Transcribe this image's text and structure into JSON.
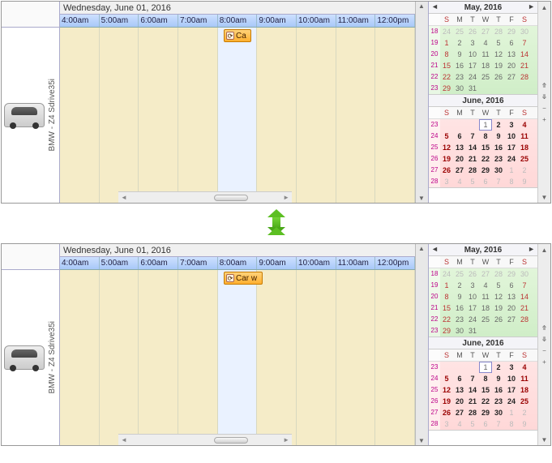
{
  "scheduler": {
    "date_header": "Wednesday, June 01, 2016",
    "hours": [
      "4:00am",
      "5:00am",
      "6:00am",
      "7:00am",
      "8:00am",
      "9:00am",
      "10:00am",
      "11:00am",
      "12:00pm"
    ],
    "resource_label": "BMW - Z4 Sdrive35i",
    "appt_top_label": "Ca",
    "appt_bottom_label": "Car w"
  },
  "calendars": {
    "may": {
      "title": "May, 2016",
      "dow": [
        "S",
        "M",
        "T",
        "W",
        "T",
        "F",
        "S"
      ],
      "rows": [
        {
          "wk": "18",
          "days": [
            {
              "v": "24",
              "dim": 1
            },
            {
              "v": "25",
              "dim": 1
            },
            {
              "v": "26",
              "dim": 1
            },
            {
              "v": "27",
              "dim": 1
            },
            {
              "v": "28",
              "dim": 1
            },
            {
              "v": "29",
              "dim": 1
            },
            {
              "v": "30",
              "dim": 1
            }
          ]
        },
        {
          "wk": "19",
          "days": [
            {
              "v": "1",
              "w": 1
            },
            {
              "v": "2"
            },
            {
              "v": "3"
            },
            {
              "v": "4"
            },
            {
              "v": "5"
            },
            {
              "v": "6"
            },
            {
              "v": "7",
              "w": 1
            }
          ]
        },
        {
          "wk": "20",
          "days": [
            {
              "v": "8",
              "w": 1
            },
            {
              "v": "9"
            },
            {
              "v": "10"
            },
            {
              "v": "11"
            },
            {
              "v": "12"
            },
            {
              "v": "13"
            },
            {
              "v": "14",
              "w": 1
            }
          ]
        },
        {
          "wk": "21",
          "days": [
            {
              "v": "15",
              "w": 1
            },
            {
              "v": "16"
            },
            {
              "v": "17"
            },
            {
              "v": "18"
            },
            {
              "v": "19"
            },
            {
              "v": "20"
            },
            {
              "v": "21",
              "w": 1
            }
          ]
        },
        {
          "wk": "22",
          "days": [
            {
              "v": "22",
              "w": 1
            },
            {
              "v": "23"
            },
            {
              "v": "24"
            },
            {
              "v": "25"
            },
            {
              "v": "26"
            },
            {
              "v": "27"
            },
            {
              "v": "28",
              "w": 1
            }
          ]
        },
        {
          "wk": "23",
          "days": [
            {
              "v": "29",
              "w": 1
            },
            {
              "v": "30"
            },
            {
              "v": "31"
            }
          ]
        }
      ]
    },
    "jun": {
      "title": "June, 2016",
      "dow": [
        "S",
        "M",
        "T",
        "W",
        "T",
        "F",
        "S"
      ],
      "rows": [
        {
          "wk": "23",
          "days": [
            {
              "v": ""
            },
            {
              "v": ""
            },
            {
              "v": ""
            },
            {
              "v": "1",
              "today": 1
            },
            {
              "v": "2",
              "b": 1
            },
            {
              "v": "3",
              "b": 1
            },
            {
              "v": "4",
              "b": 1,
              "w": 1
            }
          ]
        },
        {
          "wk": "24",
          "days": [
            {
              "v": "5",
              "b": 1,
              "w": 1
            },
            {
              "v": "6",
              "b": 1
            },
            {
              "v": "7",
              "b": 1
            },
            {
              "v": "8",
              "b": 1
            },
            {
              "v": "9",
              "b": 1
            },
            {
              "v": "10",
              "b": 1
            },
            {
              "v": "11",
              "b": 1,
              "w": 1
            }
          ]
        },
        {
          "wk": "25",
          "days": [
            {
              "v": "12",
              "b": 1,
              "w": 1
            },
            {
              "v": "13",
              "b": 1
            },
            {
              "v": "14",
              "b": 1
            },
            {
              "v": "15",
              "b": 1
            },
            {
              "v": "16",
              "b": 1
            },
            {
              "v": "17",
              "b": 1
            },
            {
              "v": "18",
              "b": 1,
              "w": 1
            }
          ]
        },
        {
          "wk": "26",
          "days": [
            {
              "v": "19",
              "b": 1,
              "w": 1
            },
            {
              "v": "20",
              "b": 1
            },
            {
              "v": "21",
              "b": 1
            },
            {
              "v": "22",
              "b": 1
            },
            {
              "v": "23",
              "b": 1
            },
            {
              "v": "24",
              "b": 1
            },
            {
              "v": "25",
              "b": 1,
              "w": 1
            }
          ]
        },
        {
          "wk": "27",
          "days": [
            {
              "v": "26",
              "b": 1,
              "w": 1
            },
            {
              "v": "27",
              "b": 1
            },
            {
              "v": "28",
              "b": 1
            },
            {
              "v": "29",
              "b": 1
            },
            {
              "v": "30",
              "b": 1
            },
            {
              "v": "1",
              "dim": 1
            },
            {
              "v": "2",
              "dim": 1
            }
          ]
        },
        {
          "wk": "28",
          "days": [
            {
              "v": "3",
              "dim": 1
            },
            {
              "v": "4",
              "dim": 1
            },
            {
              "v": "5",
              "dim": 1
            },
            {
              "v": "6",
              "dim": 1
            },
            {
              "v": "7",
              "dim": 1
            },
            {
              "v": "8",
              "dim": 1
            },
            {
              "v": "9",
              "dim": 1
            }
          ]
        }
      ]
    }
  }
}
